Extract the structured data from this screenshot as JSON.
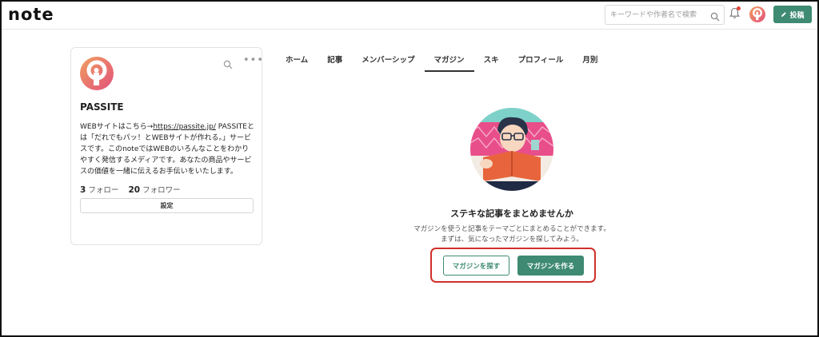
{
  "header": {
    "logo": "note",
    "search_placeholder": "キーワードや作者名で検索",
    "post_label": "投稿"
  },
  "profile": {
    "name": "PASSITE",
    "bio_prefix": "WEBサイトはこちら→",
    "bio_link": "https://passite.jp/",
    "bio_suffix": " PASSITEとは「だれでもパッ！とWEBサイトが作れる。」サービスです。このnoteではWEBのいろんなことをわかりやすく発信するメディアです。あなたの商品やサービスの価値を一緒に伝えるお手伝いをいたします。",
    "follow_count": "3",
    "follow_label": "フォロー",
    "follower_count": "20",
    "follower_label": "フォロワー",
    "settings_label": "設定"
  },
  "tabs": [
    {
      "label": "ホーム"
    },
    {
      "label": "記事"
    },
    {
      "label": "メンバーシップ"
    },
    {
      "label": "マガジン"
    },
    {
      "label": "スキ"
    },
    {
      "label": "プロフィール"
    },
    {
      "label": "月別"
    }
  ],
  "active_tab": "マガジン",
  "empty_state": {
    "title": "ステキな記事をまとめませんか",
    "desc_line1": "マガジンを使うと記事をテーマごとにまとめることができます。",
    "desc_line2": "まずは、気になったマガジンを探してみよう。",
    "find_label": "マガジンを探す",
    "create_label": "マガジンを作る"
  },
  "colors": {
    "accent": "#3e8a72",
    "highlight": "#d0302a",
    "avatar_pink": "#e8677a",
    "avatar_orange": "#f0a060"
  },
  "icons": [
    "search-icon",
    "bell-icon",
    "pencil-icon",
    "more-icon"
  ]
}
